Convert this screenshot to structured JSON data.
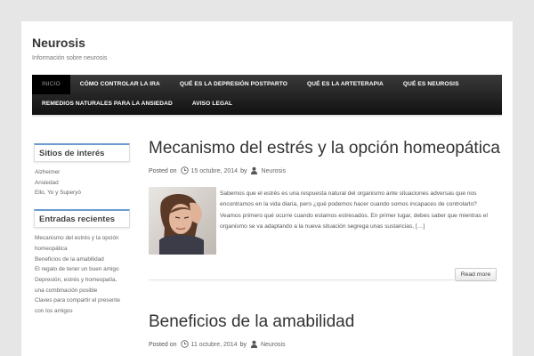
{
  "site": {
    "title": "Neurosis",
    "description": "Información sobre neurosis"
  },
  "nav": {
    "row1": [
      "Inicio",
      "Cómo controlar la ira",
      "Qué es la depresión postparto",
      "Qué es la arteterapia",
      "Qué es neurosis"
    ],
    "row2": [
      "Remedios naturales para la ansiedad",
      "Aviso legal"
    ]
  },
  "sidebar": {
    "interest": {
      "title": "Sitios de interés",
      "items": [
        "Alzheimer",
        "Ansiedad",
        "Ello, Yo y Superyó"
      ]
    },
    "recent": {
      "title": "Entradas recientes",
      "items": [
        "Mecanismo del estrés y la opción",
        "homeopática",
        "Beneficios de la amabilidad",
        "El regalo de tener un buen amigo",
        "Depresión, estrés y homeopatía,",
        "una combinación posible",
        "Claves para compartir el presente",
        "con los amigos"
      ]
    }
  },
  "posts": [
    {
      "title": "Mecanismo del estrés y la opción homeopática",
      "posted_on": "Posted on",
      "date": "15 octubre, 2014",
      "by": "by",
      "author": "Neurosis",
      "excerpt": "Sabemos que el estrés es una respuesta natural del organismo ante situaciones adversas que nos encontramos en la vida diaria, pero ¿qué podemos hacer cuando somos incapaces de controlarlo? Veamos primero qué ocurre cuando estamos estresados. En primer lugar, debes saber que mientras el organismo se va adaptando a la nueva situación segrega unas sustancias, […]",
      "read_more": "Read more"
    },
    {
      "title": "Beneficios de la amabilidad",
      "posted_on": "Posted on",
      "date": "11 octubre, 2014",
      "by": "by",
      "author": "Neurosis"
    }
  ],
  "colors": {
    "nav_bg": "#1f1f1f",
    "widget_accent": "#6c9bd2",
    "page_bg": "#e6e6e6"
  }
}
